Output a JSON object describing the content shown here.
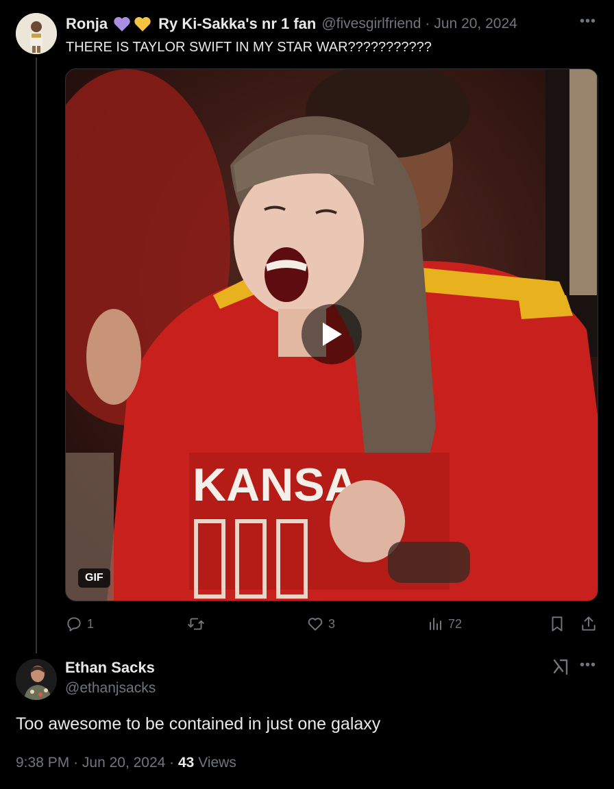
{
  "post1": {
    "name": "Ronja",
    "name_suffix": "Ry Ki-Sakka's nr 1 fan",
    "handle": "@fivesgirlfriend",
    "date": "Jun 20, 2024",
    "text": "THERE IS TAYLOR SWIFT IN MY STAR WAR???????????",
    "media_badge": "GIF",
    "name_emojis": [
      "purple-heart-icon",
      "yellow-heart-icon"
    ],
    "actions": {
      "replies": "1",
      "reposts": "",
      "likes": "3",
      "views": "72"
    },
    "media_text": "KANSA"
  },
  "post2": {
    "name": "Ethan Sacks",
    "handle": "@ethanjsacks",
    "text": "Too awesome to be contained in just one galaxy",
    "time": "9:38 PM",
    "date": "Jun 20, 2024",
    "views_count": "43",
    "views_label": "Views"
  },
  "colors": {
    "background": "#000000",
    "text": "#e7e9ea",
    "muted": "#71767b",
    "jersey_red": "#c8201c",
    "stripe_yellow": "#e8b21f"
  }
}
